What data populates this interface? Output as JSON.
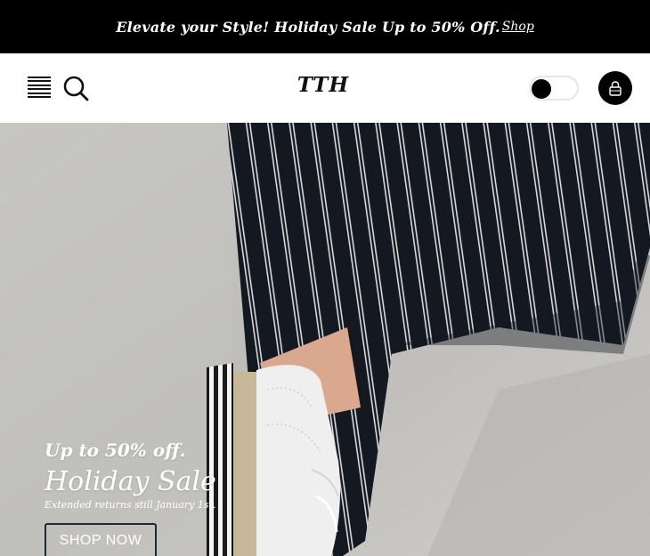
{
  "announcement": {
    "text": "Elevate your Style! Holiday Sale Up to 50% Off.",
    "link_label": "Shop"
  },
  "header": {
    "menu_icon": "hamburger-menu-icon",
    "search_icon": "search-icon",
    "logo": "TTH",
    "theme_toggle_icon": "dark-mode-toggle",
    "account_icon": "lock-icon"
  },
  "hero": {
    "kicker": "Up to 50% off.",
    "title": "Holiday Sale",
    "subtitle": "Extended returns still January 1st.",
    "cta_label": "SHOP NOW"
  },
  "colors": {
    "announcement_bg": "#000000",
    "header_bg": "#ffffff",
    "accent": "#000000",
    "hero_text": "#ffffff"
  }
}
